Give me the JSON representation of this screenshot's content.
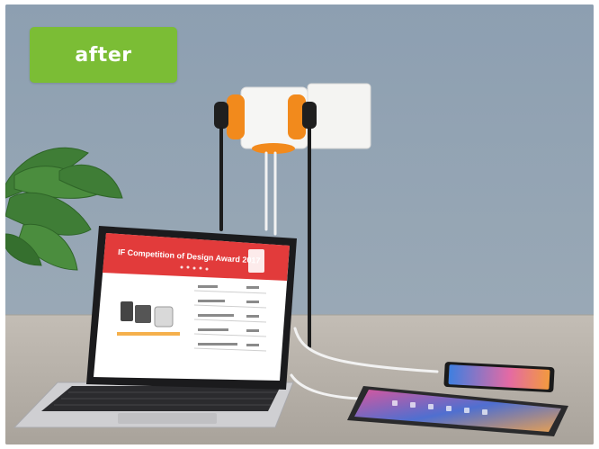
{
  "badge": {
    "label": "after",
    "color": "#7bbd35"
  },
  "colors": {
    "wall": "#8d9fb0",
    "desk": "#b9b4ad",
    "adapter_accent": "#f28a1c",
    "screen_header": "#e23b3b"
  },
  "laptop_screen": {
    "title": "IF Competition of Design Award 2017"
  }
}
